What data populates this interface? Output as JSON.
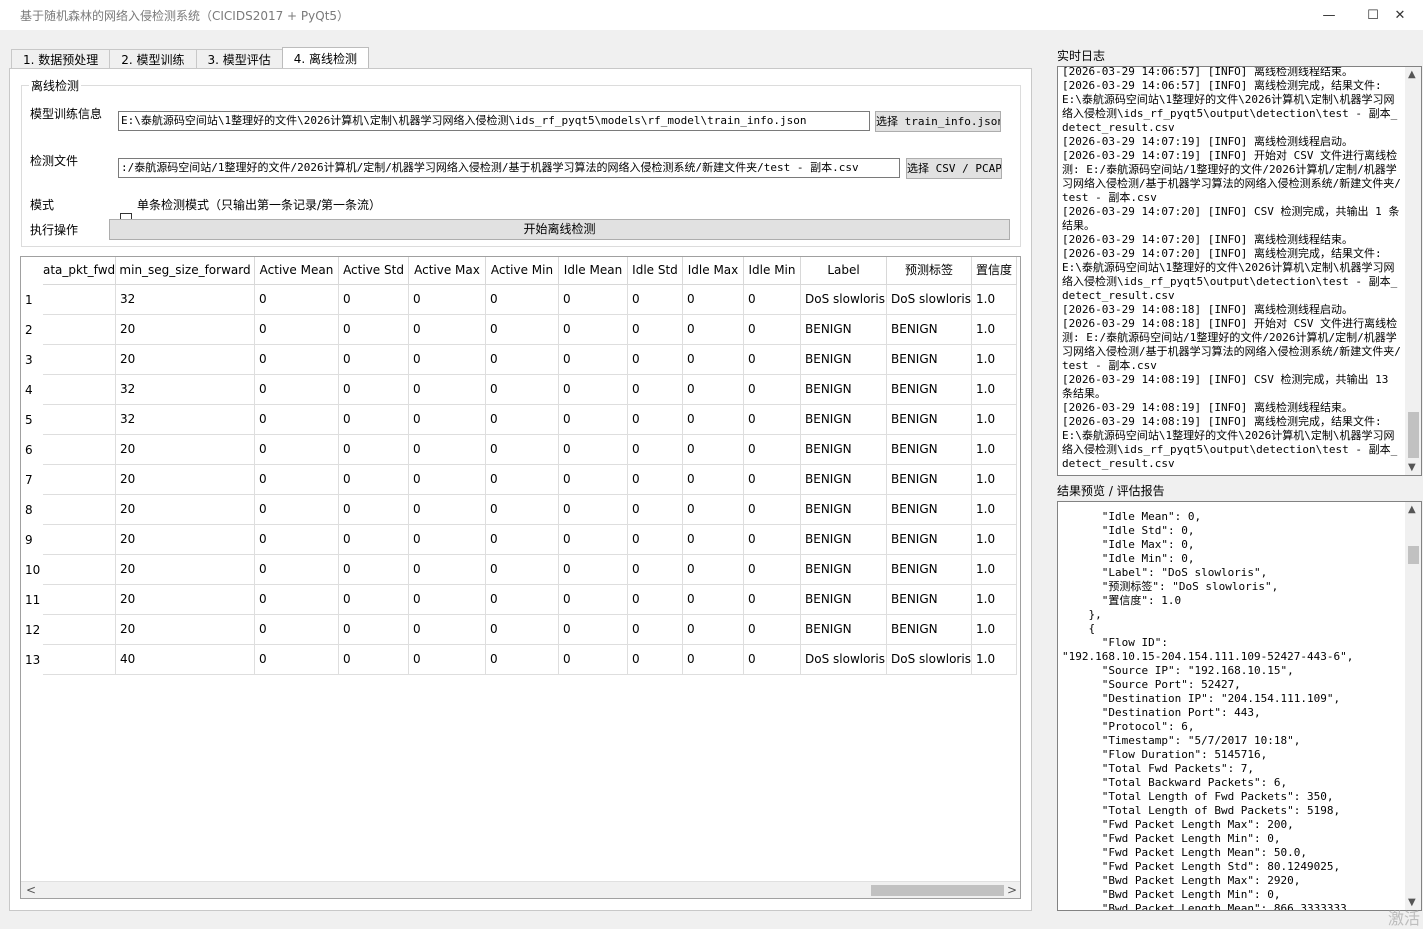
{
  "window": {
    "title": "基于随机森林的网络入侵检测系统（CICIDS2017 + PyQt5）",
    "minimize": "—",
    "maximize": "☐",
    "close": "✕"
  },
  "tabs": [
    {
      "label": "1. 数据预处理"
    },
    {
      "label": "2. 模型训练"
    },
    {
      "label": "3. 模型评估"
    },
    {
      "label": "4. 离线检测"
    }
  ],
  "offline": {
    "group_title": "离线检测",
    "train_info_label": "模型训练信息",
    "train_info_path": "E:\\泰航源码空间站\\1整理好的文件\\2026计算机\\定制\\机器学习网络入侵检测\\ids_rf_pyqt5\\models\\rf_model\\train_info.json",
    "train_info_button": "选择 train_info.json",
    "detect_file_label": "检测文件",
    "detect_file_path": ":/泰航源码空间站/1整理好的文件/2026计算机/定制/机器学习网络入侵检测/基于机器学习算法的网络入侵检测系统/新建文件夹/test - 副本.csv",
    "detect_file_button": "选择 CSV / PCAP",
    "mode_label": "模式",
    "single_mode_label": "单条检测模式（只输出第一条记录/第一条流）",
    "action_label": "执行操作",
    "start_button": "开始离线检测"
  },
  "table": {
    "columns": [
      "ata_pkt_fwd",
      "min_seg_size_forward",
      "Active Mean",
      "Active Std",
      "Active Max",
      "Active Min",
      "Idle Mean",
      "Idle Std",
      "Idle Max",
      "Idle Min",
      "Label",
      "预测标签",
      "置信度"
    ],
    "rows": [
      [
        "1",
        "",
        "32",
        "0",
        "0",
        "0",
        "0",
        "0",
        "0",
        "0",
        "0",
        "DoS slowloris",
        "DoS slowloris",
        "1.0"
      ],
      [
        "2",
        "",
        "20",
        "0",
        "0",
        "0",
        "0",
        "0",
        "0",
        "0",
        "0",
        "BENIGN",
        "BENIGN",
        "1.0"
      ],
      [
        "3",
        "",
        "20",
        "0",
        "0",
        "0",
        "0",
        "0",
        "0",
        "0",
        "0",
        "BENIGN",
        "BENIGN",
        "1.0"
      ],
      [
        "4",
        "",
        "32",
        "0",
        "0",
        "0",
        "0",
        "0",
        "0",
        "0",
        "0",
        "BENIGN",
        "BENIGN",
        "1.0"
      ],
      [
        "5",
        "",
        "32",
        "0",
        "0",
        "0",
        "0",
        "0",
        "0",
        "0",
        "0",
        "BENIGN",
        "BENIGN",
        "1.0"
      ],
      [
        "6",
        "",
        "20",
        "0",
        "0",
        "0",
        "0",
        "0",
        "0",
        "0",
        "0",
        "BENIGN",
        "BENIGN",
        "1.0"
      ],
      [
        "7",
        "",
        "20",
        "0",
        "0",
        "0",
        "0",
        "0",
        "0",
        "0",
        "0",
        "BENIGN",
        "BENIGN",
        "1.0"
      ],
      [
        "8",
        "",
        "20",
        "0",
        "0",
        "0",
        "0",
        "0",
        "0",
        "0",
        "0",
        "BENIGN",
        "BENIGN",
        "1.0"
      ],
      [
        "9",
        "",
        "20",
        "0",
        "0",
        "0",
        "0",
        "0",
        "0",
        "0",
        "0",
        "BENIGN",
        "BENIGN",
        "1.0"
      ],
      [
        "10",
        "",
        "20",
        "0",
        "0",
        "0",
        "0",
        "0",
        "0",
        "0",
        "0",
        "BENIGN",
        "BENIGN",
        "1.0"
      ],
      [
        "11",
        "",
        "20",
        "0",
        "0",
        "0",
        "0",
        "0",
        "0",
        "0",
        "0",
        "BENIGN",
        "BENIGN",
        "1.0"
      ],
      [
        "12",
        "",
        "20",
        "0",
        "0",
        "0",
        "0",
        "0",
        "0",
        "0",
        "0",
        "BENIGN",
        "BENIGN",
        "1.0"
      ],
      [
        "13",
        "",
        "40",
        "0",
        "0",
        "0",
        "0",
        "0",
        "0",
        "0",
        "0",
        "DoS slowloris",
        "DoS slowloris",
        "1.0"
      ]
    ]
  },
  "log": {
    "label": "实时日志",
    "lines": [
      "[2026-03-29 14:06:57] [INFO] 离线检测线程结束。",
      "[2026-03-29 14:06:57] [INFO] 离线检测完成，结果文件: E:\\泰航源码空间站\\1整理好的文件\\2026计算机\\定制\\机器学习网络入侵检测\\ids_rf_pyqt5\\output\\detection\\test - 副本_detect_result.csv",
      "[2026-03-29 14:07:19] [INFO] 离线检测线程启动。",
      "[2026-03-29 14:07:19] [INFO] 开始对 CSV 文件进行离线检测: E:/泰航源码空间站/1整理好的文件/2026计算机/定制/机器学习网络入侵检测/基于机器学习算法的网络入侵检测系统/新建文件夹/test - 副本.csv",
      "[2026-03-29 14:07:20] [INFO] CSV 检测完成，共输出 1 条结果。",
      "[2026-03-29 14:07:20] [INFO] 离线检测线程结束。",
      "[2026-03-29 14:07:20] [INFO] 离线检测完成，结果文件: E:\\泰航源码空间站\\1整理好的文件\\2026计算机\\定制\\机器学习网络入侵检测\\ids_rf_pyqt5\\output\\detection\\test - 副本_detect_result.csv",
      "[2026-03-29 14:08:18] [INFO] 离线检测线程启动。",
      "[2026-03-29 14:08:18] [INFO] 开始对 CSV 文件进行离线检测: E:/泰航源码空间站/1整理好的文件/2026计算机/定制/机器学习网络入侵检测/基于机器学习算法的网络入侵检测系统/新建文件夹/test - 副本.csv",
      "[2026-03-29 14:08:19] [INFO] CSV 检测完成，共输出 13 条结果。",
      "[2026-03-29 14:08:19] [INFO] 离线检测线程结束。",
      "[2026-03-29 14:08:19] [INFO] 离线检测完成，结果文件: E:\\泰航源码空间站\\1整理好的文件\\2026计算机\\定制\\机器学习网络入侵检测\\ids_rf_pyqt5\\output\\detection\\test - 副本_detect_result.csv"
    ]
  },
  "report": {
    "label": "结果预览 / 评估报告",
    "lines": [
      "      \"Idle Mean\": 0,",
      "      \"Idle Std\": 0,",
      "      \"Idle Max\": 0,",
      "      \"Idle Min\": 0,",
      "      \"Label\": \"DoS slowloris\",",
      "      \"预测标签\": \"DoS slowloris\",",
      "      \"置信度\": 1.0",
      "    },",
      "    {",
      "      \"Flow ID\":",
      "\"192.168.10.15-204.154.111.109-52427-443-6\",",
      "      \"Source IP\": \"192.168.10.15\",",
      "      \"Source Port\": 52427,",
      "      \"Destination IP\": \"204.154.111.109\",",
      "      \"Destination Port\": 443,",
      "      \"Protocol\": 6,",
      "      \"Timestamp\": \"5/7/2017 10:18\",",
      "      \"Flow Duration\": 5145716,",
      "      \"Total Fwd Packets\": 7,",
      "      \"Total Backward Packets\": 6,",
      "      \"Total Length of Fwd Packets\": 350,",
      "      \"Total Length of Bwd Packets\": 5198,",
      "      \"Fwd Packet Length Max\": 200,",
      "      \"Fwd Packet Length Min\": 0,",
      "      \"Fwd Packet Length Mean\": 50.0,",
      "      \"Fwd Packet Length Std\": 80.1249025,",
      "      \"Bwd Packet Length Max\": 2920,",
      "      \"Bwd Packet Length Min\": 0,",
      "      \"Bwd Packet Length Mean\": 866.3333333,"
    ]
  },
  "watermark": "激活"
}
